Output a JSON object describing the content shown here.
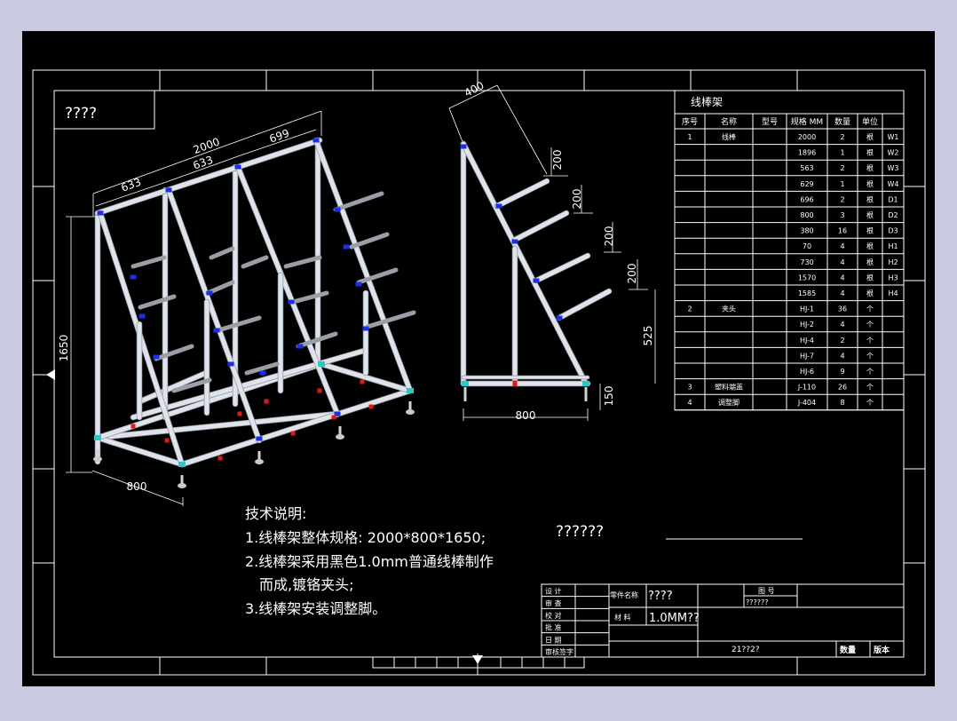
{
  "title_box": {
    "text": "????"
  },
  "center_label": {
    "text": "??????"
  },
  "front_view": {
    "dims": {
      "length_total": "2000",
      "seg_a": "633",
      "seg_b": "633",
      "seg_c": "699",
      "height": "1650",
      "depth": "800"
    }
  },
  "side_view": {
    "dims": {
      "top_width": "400",
      "gap1": "200",
      "gap2": "200",
      "gap3": "200",
      "gap4": "200",
      "lower": "525",
      "foot": "150",
      "width": "800"
    }
  },
  "bom": {
    "title": "线棒架",
    "headers": [
      "序号",
      "名称",
      "型号",
      "规格 MM",
      "数量",
      "单位"
    ],
    "rows": [
      [
        "1",
        "线棒",
        "",
        "2000",
        "2",
        "根",
        "W1"
      ],
      [
        "",
        "",
        "",
        "1896",
        "1",
        "根",
        "W2"
      ],
      [
        "",
        "",
        "",
        "563",
        "2",
        "根",
        "W3"
      ],
      [
        "",
        "",
        "",
        "629",
        "1",
        "根",
        "W4"
      ],
      [
        "",
        "",
        "",
        "696",
        "2",
        "根",
        "D1"
      ],
      [
        "",
        "",
        "",
        "800",
        "3",
        "根",
        "D2"
      ],
      [
        "",
        "",
        "",
        "380",
        "16",
        "根",
        "D3"
      ],
      [
        "",
        "",
        "",
        "70",
        "4",
        "根",
        "H1"
      ],
      [
        "",
        "",
        "",
        "730",
        "4",
        "根",
        "H2"
      ],
      [
        "",
        "",
        "",
        "1570",
        "4",
        "根",
        "H3"
      ],
      [
        "",
        "",
        "",
        "1585",
        "4",
        "根",
        "H4"
      ],
      [
        "2",
        "夹头",
        "",
        "HJ-1",
        "36",
        "个",
        ""
      ],
      [
        "",
        "",
        "",
        "HJ-2",
        "4",
        "个",
        ""
      ],
      [
        "",
        "",
        "",
        "HJ-4",
        "2",
        "个",
        ""
      ],
      [
        "",
        "",
        "",
        "HJ-7",
        "4",
        "个",
        ""
      ],
      [
        "",
        "",
        "",
        "HJ-6",
        "9",
        "个",
        ""
      ],
      [
        "3",
        "塑料端盖",
        "",
        "J-110",
        "26",
        "个",
        ""
      ],
      [
        "4",
        "调整脚",
        "",
        "J-404",
        "8",
        "个",
        ""
      ]
    ]
  },
  "notes": {
    "heading": "技术说明:",
    "line1": "1.线棒架整体规格: 2000*800*1650;",
    "line2": "2.线棒架采用黑色1.0mm普通线棒制作",
    "line3": "而成,镀铬夹头;",
    "line4": "3.线棒架安装调整脚。"
  },
  "title_block": {
    "roles": [
      "设 计",
      "审 查",
      "校 对",
      "批 准",
      "日 期",
      "审核签字"
    ],
    "part_label": "零件名称",
    "part_name": "????",
    "material_label": "材 料",
    "material": "1.0MM??",
    "drawing_no_label": "图 号",
    "drawing_no": "??????",
    "code": "21??2?",
    "qty_label": "数量",
    "version_label": "版本"
  },
  "colors": {
    "background": "#000000",
    "frame": "#ffffff",
    "pipe": "#dfe3ea",
    "bar": "#9a9ea6",
    "joint_blue": "#1a2fe6",
    "joint_red": "#e01818",
    "joint_cyan": "#2cc7c7"
  }
}
